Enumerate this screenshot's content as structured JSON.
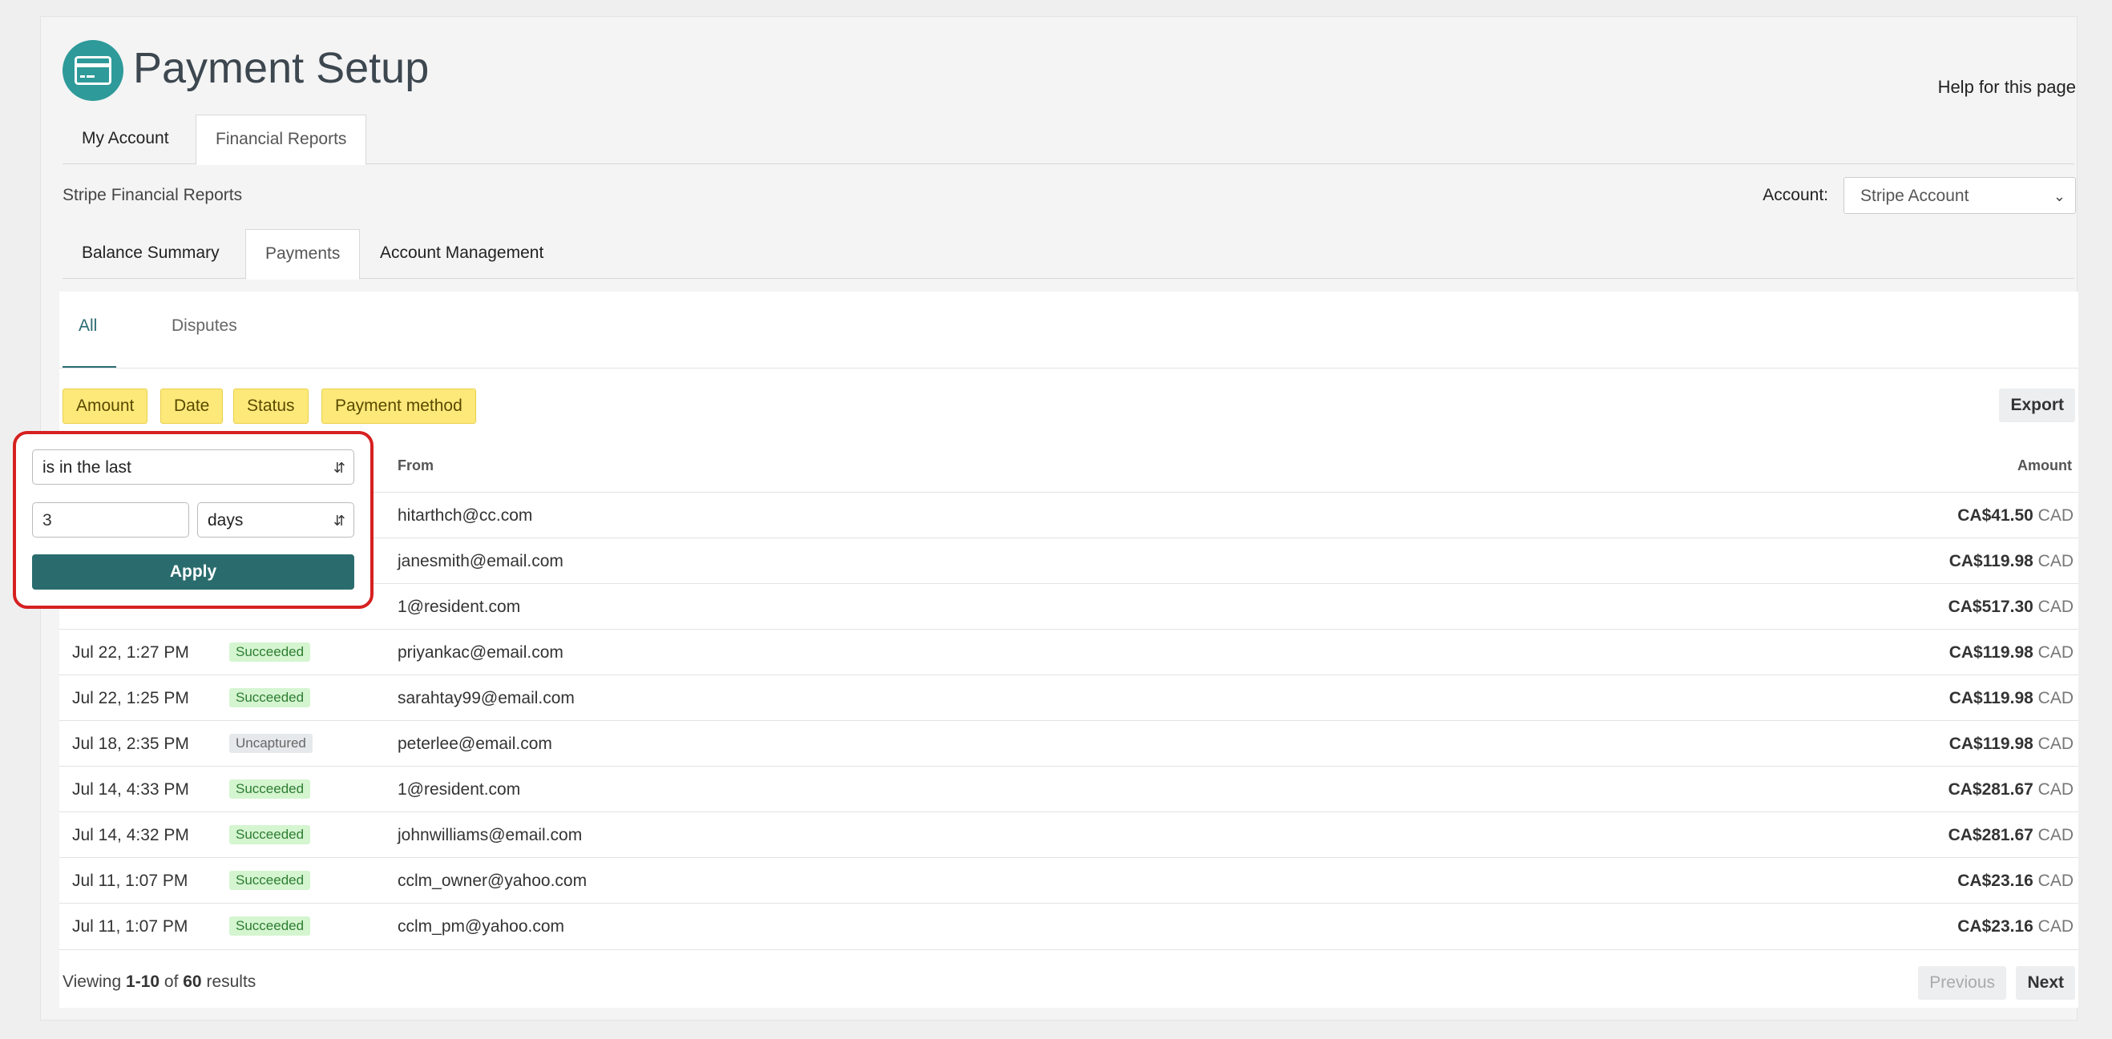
{
  "header": {
    "title": "Payment Setup",
    "help": "Help for this page",
    "icon": "credit-card-icon",
    "accent": "#2e9a9a"
  },
  "top_tabs": [
    {
      "label": "My Account"
    },
    {
      "label": "Financial Reports"
    }
  ],
  "subtitle": "Stripe Financial Reports",
  "account": {
    "label": "Account:",
    "value": "Stripe Account"
  },
  "report_tabs": [
    {
      "label": "Balance Summary"
    },
    {
      "label": "Payments"
    },
    {
      "label": "Account Management"
    }
  ],
  "payment_tabs": [
    {
      "label": "All"
    },
    {
      "label": "Disputes"
    }
  ],
  "filters": [
    {
      "label": "Amount"
    },
    {
      "label": "Date"
    },
    {
      "label": "Status"
    },
    {
      "label": "Payment method"
    }
  ],
  "export_label": "Export",
  "columns": {
    "from": "From",
    "amount": "Amount"
  },
  "rows": [
    {
      "date": "",
      "status": "",
      "from": "hitarthch@cc.com",
      "amount": "CA$41.50",
      "currency": "CAD"
    },
    {
      "date": "",
      "status": "",
      "from": "janesmith@email.com",
      "amount": "CA$119.98",
      "currency": "CAD"
    },
    {
      "date": "",
      "status": "",
      "from": "1@resident.com",
      "amount": "CA$517.30",
      "currency": "CAD"
    },
    {
      "date": "Jul 22, 1:27 PM",
      "status": "Succeeded",
      "from": "priyankac@email.com",
      "amount": "CA$119.98",
      "currency": "CAD"
    },
    {
      "date": "Jul 22, 1:25 PM",
      "status": "Succeeded",
      "from": "sarahtay99@email.com",
      "amount": "CA$119.98",
      "currency": "CAD"
    },
    {
      "date": "Jul 18, 2:35 PM",
      "status": "Uncaptured",
      "from": "peterlee@email.com",
      "amount": "CA$119.98",
      "currency": "CAD"
    },
    {
      "date": "Jul 14, 4:33 PM",
      "status": "Succeeded",
      "from": "1@resident.com",
      "amount": "CA$281.67",
      "currency": "CAD"
    },
    {
      "date": "Jul 14, 4:32 PM",
      "status": "Succeeded",
      "from": "johnwilliams@email.com",
      "amount": "CA$281.67",
      "currency": "CAD"
    },
    {
      "date": "Jul 11, 1:07 PM",
      "status": "Succeeded",
      "from": "cclm_owner@yahoo.com",
      "amount": "CA$23.16",
      "currency": "CAD"
    },
    {
      "date": "Jul 11, 1:07 PM",
      "status": "Succeeded",
      "from": "cclm_pm@yahoo.com",
      "amount": "CA$23.16",
      "currency": "CAD"
    }
  ],
  "footer": {
    "viewing": "Viewing",
    "range": "1-10",
    "of": "of",
    "total": "60",
    "results": "results",
    "previous": "Previous",
    "next": "Next"
  },
  "popover": {
    "condition": "is in the last",
    "value": "3",
    "unit": "days",
    "apply": "Apply",
    "highlight_color": "#d62020"
  }
}
